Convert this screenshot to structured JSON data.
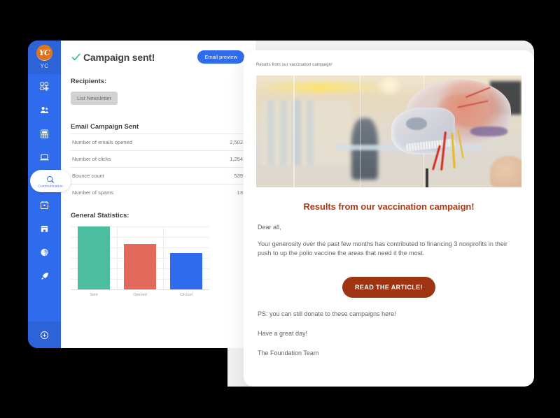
{
  "sidebar": {
    "logo_initials": "YC",
    "org_label": "YC",
    "items": [
      {
        "icon": "dashboard-add-icon",
        "label": "Dashboard",
        "active": false
      },
      {
        "icon": "contacts-icon",
        "label": "Contacts",
        "active": false
      },
      {
        "icon": "accounting-icon",
        "label": "Accounting",
        "active": false
      },
      {
        "icon": "website-icon",
        "label": "Website",
        "active": false
      },
      {
        "icon": "communication-icon",
        "label": "Communication",
        "active": true
      },
      {
        "icon": "calendar-icon",
        "label": "Calendar",
        "active": false
      },
      {
        "icon": "shop-icon",
        "label": "Shop",
        "active": false
      },
      {
        "icon": "analytics-icon",
        "label": "Analytics",
        "active": false
      },
      {
        "icon": "rocket-icon",
        "label": "Launch",
        "active": false
      }
    ],
    "add_button": {
      "icon": "plus-circle-icon",
      "label": "Add app"
    }
  },
  "header": {
    "status_icon": "check-icon",
    "title": "Campaign sent!",
    "preview_button": "Email preview"
  },
  "recipients": {
    "label": "Recipients:",
    "chips": [
      "List Newsletter"
    ]
  },
  "campaign_stats": {
    "title": "Email Campaign Sent",
    "rows": [
      {
        "label": "Number of emails opened",
        "value": "2,502"
      },
      {
        "label": "Number of clicks",
        "value": "1,254"
      },
      {
        "label": "Bounce count",
        "value": "539"
      },
      {
        "label": "Number of spams",
        "value": "13"
      }
    ]
  },
  "chart_data": {
    "type": "bar",
    "title": "General Statistics:",
    "categories": [
      "Sent",
      "Opened",
      "Clicked"
    ],
    "values": [
      100,
      72,
      58
    ],
    "colors": [
      "#4cbd9e",
      "#e3695a",
      "#2f6ced"
    ],
    "xlabel": "",
    "ylabel": "",
    "ylim": [
      0,
      100
    ],
    "grid": true,
    "legend": "none"
  },
  "email_preview": {
    "subject": "Results from our vaccination campaign!",
    "hero_image_alt": "transparent anatomical skull model in a classroom",
    "heading": "Results from our vaccination campaign!",
    "greeting": "Dear all,",
    "paragraph": "Your generosity over the past few months has contributed to financing 3 nonprofits in their push to up the polio vaccine the areas that need it the most.",
    "cta_label": "READ THE ARTICLE!",
    "ps": "PS: you can still donate to these campaigns here!",
    "closing": "Have a great day!",
    "signature": "The Foundation Team"
  },
  "colors": {
    "brand_blue": "#2f6ced",
    "brand_blue_dark": "#2c63d8",
    "logo_orange": "#e2721a",
    "success_green": "#1fbf8f",
    "cta_rust": "#9e3412",
    "heading_rust": "#b03a10",
    "bar_green": "#4cbd9e",
    "bar_red": "#e3695a",
    "bar_blue": "#2f6ced"
  }
}
